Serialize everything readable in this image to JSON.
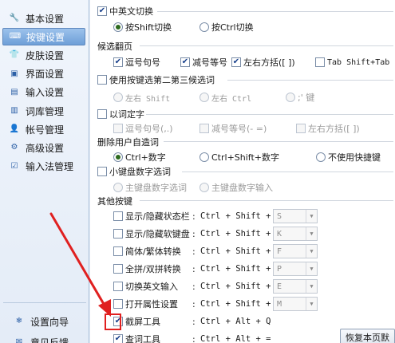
{
  "sidebar": {
    "items": [
      {
        "label": "基本设置",
        "icon": "wrench-icon",
        "glyph": "🔧"
      },
      {
        "label": "按键设置",
        "icon": "keyboard-icon",
        "glyph": "⌨"
      },
      {
        "label": "皮肤设置",
        "icon": "shirt-icon",
        "glyph": "👕"
      },
      {
        "label": "界面设置",
        "icon": "window-icon",
        "glyph": "▣"
      },
      {
        "label": "输入设置",
        "icon": "input-icon",
        "glyph": "▤"
      },
      {
        "label": "词库管理",
        "icon": "dictionary-icon",
        "glyph": "▥"
      },
      {
        "label": "帐号管理",
        "icon": "account-icon",
        "glyph": "👤"
      },
      {
        "label": "高级设置",
        "icon": "advanced-icon",
        "glyph": "⚙"
      },
      {
        "label": "输入法管理",
        "icon": "ime-manage-icon",
        "glyph": "☑"
      }
    ],
    "active_index": 1,
    "bottom": [
      {
        "label": "设置向导",
        "icon": "wizard-icon",
        "glyph": "❄"
      },
      {
        "label": "意见反馈",
        "icon": "feedback-icon",
        "glyph": "✉"
      }
    ]
  },
  "main": {
    "cn_en_switch": {
      "label": "中英文切换",
      "checked": true,
      "options": [
        "按Shift切换",
        "按Ctrl切换"
      ],
      "selected": 0
    },
    "page_turn": {
      "title": "候选翻页",
      "options": [
        {
          "label": "逗号句号",
          "checked": true
        },
        {
          "label": "减号等号",
          "checked": true
        },
        {
          "label": "左右方括([ ])",
          "checked": true
        },
        {
          "label": "Tab Shift+Tab",
          "checked": false
        }
      ]
    },
    "select_2_3": {
      "label": "使用按键选第二第三候选词",
      "checked": false,
      "options": [
        "左右 Shift",
        "左右 Ctrl",
        ";' 键"
      ]
    },
    "fix_word": {
      "label": "以词定字",
      "checked": false,
      "options": [
        "逗号句号(,.)",
        "减号等号(- =)",
        "左右方括([ ])"
      ]
    },
    "delete_user_word": {
      "title": "删除用户自造词",
      "options": [
        "Ctrl+数字",
        "Ctrl+Shift+数字",
        "不使用快捷键"
      ],
      "selected": 0
    },
    "numpad": {
      "label": "小键盘数字选词",
      "checked": false,
      "options": [
        "主键盘数字选词",
        "主键盘数字输入"
      ]
    },
    "other_keys": {
      "title": "其他按键",
      "rows": [
        {
          "label": "显示/隐藏状态栏",
          "keys": "Ctrl + Shift +",
          "combo": "S",
          "checked": false
        },
        {
          "label": "显示/隐藏软键盘",
          "keys": "Ctrl + Shift +",
          "combo": "K",
          "checked": false
        },
        {
          "label": "简体/繁体转换",
          "keys": "Ctrl + Shift +",
          "combo": "F",
          "checked": false
        },
        {
          "label": "全拼/双拼转换",
          "keys": "Ctrl + Shift +",
          "combo": "P",
          "checked": false
        },
        {
          "label": "切换英文输入",
          "keys": "Ctrl + Shift +",
          "combo": "E",
          "checked": false
        },
        {
          "label": "打开属性设置",
          "keys": "Ctrl + Shift +",
          "combo": "M",
          "checked": false
        },
        {
          "label": "截屏工具",
          "keys": "Ctrl + Alt + Q",
          "checked": true
        },
        {
          "label": "查词工具",
          "keys": "Ctrl + Alt + =",
          "checked": true
        }
      ]
    },
    "restore_button": "恢复本页默"
  },
  "annotation": {
    "color": "#e02020"
  }
}
